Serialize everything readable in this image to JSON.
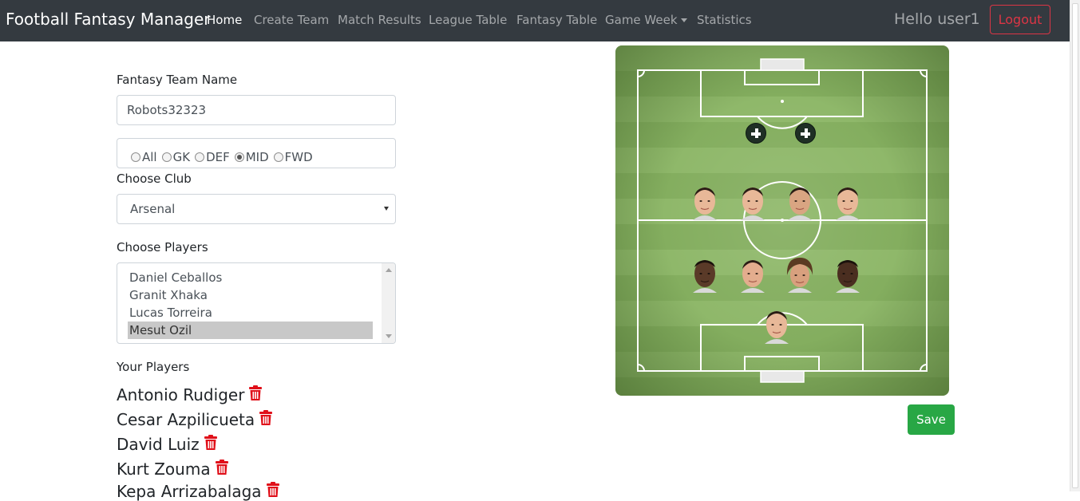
{
  "navbar": {
    "brand": "Football Fantasy Manager",
    "items": [
      {
        "label": "Home",
        "active": true
      },
      {
        "label": "Create Team"
      },
      {
        "label": "Match Results"
      },
      {
        "label": "League Table"
      },
      {
        "label": "Fantasy Table"
      },
      {
        "label": "Game Week",
        "dropdown": true
      },
      {
        "label": "Statistics"
      }
    ],
    "greeting": "Hello user1",
    "logout": "Logout"
  },
  "form": {
    "team_name_label": "Fantasy Team Name",
    "team_name_value": "Robots32323",
    "positions": [
      {
        "label": "All",
        "checked": false
      },
      {
        "label": "GK",
        "checked": false
      },
      {
        "label": "DEF",
        "checked": false
      },
      {
        "label": "MID",
        "checked": true
      },
      {
        "label": "FWD",
        "checked": false
      }
    ],
    "club_label": "Choose Club",
    "club_value": "Arsenal",
    "players_label": "Choose Players",
    "players_options": [
      "Daniel Ceballos",
      "Granit Xhaka",
      "Lucas Torreira",
      "Mesut Ozil"
    ],
    "players_selected": "Mesut Ozil"
  },
  "your_players": {
    "label": "Your Players",
    "list": [
      "Antonio Rudiger",
      "Cesar Azpilicueta",
      "David Luiz",
      "Kurt Zouma",
      "Kepa Arrizabalaga"
    ]
  },
  "pitch": {
    "empty_forward_slots": 2,
    "midfielders": 4,
    "defenders": 4,
    "goalkeepers": 1
  },
  "actions": {
    "save": "Save"
  },
  "colors": {
    "navbar": "#343a40",
    "danger": "#dc3545",
    "success": "#28a745",
    "pitch": "#8fb86a",
    "trash": "#e0101a"
  }
}
